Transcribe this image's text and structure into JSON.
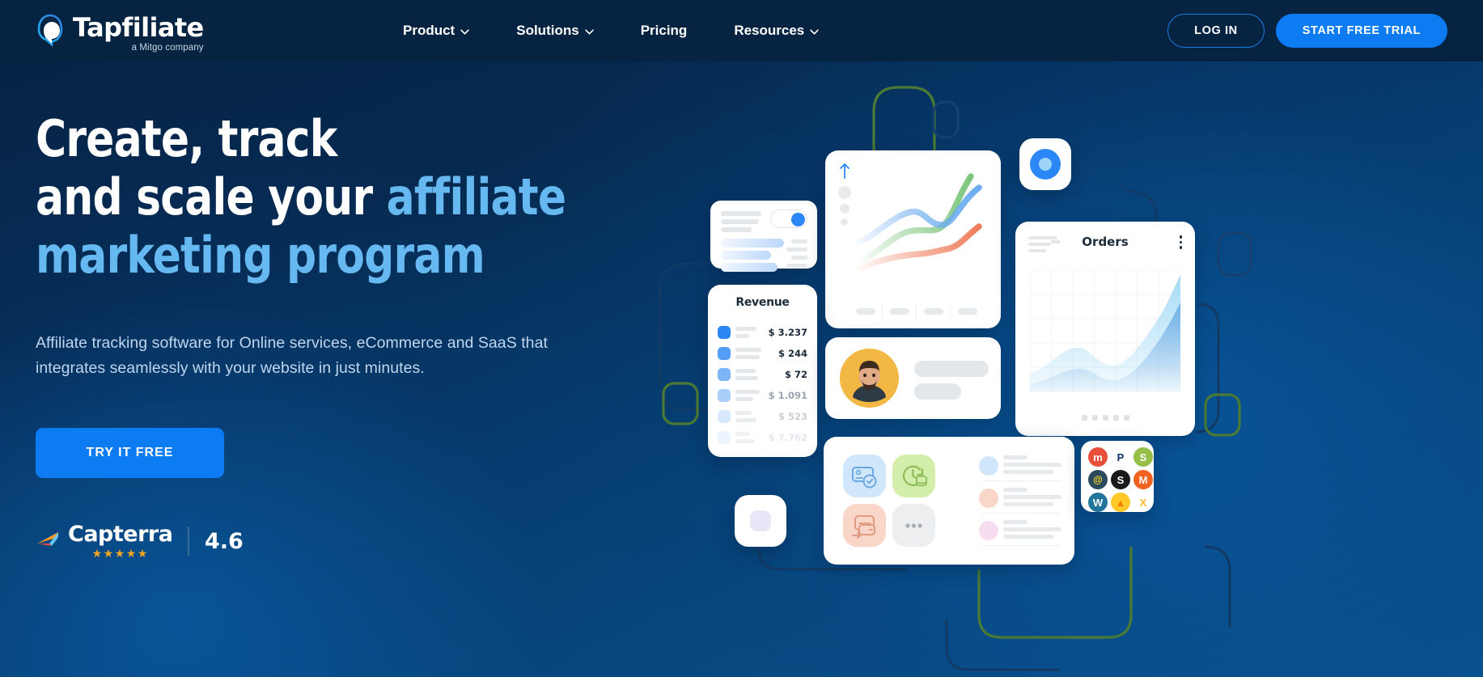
{
  "brand": {
    "name": "Tapfiliate",
    "tagline": "a Mitgo company",
    "logo_icon": "tapfiliate-logo-icon",
    "accent_color": "#0d7bf2",
    "headline_accent_color": "#66b8f0",
    "header_bg": "#062341"
  },
  "nav": {
    "items": [
      {
        "label": "Product",
        "has_dropdown": true,
        "icon": "chevron-down-icon"
      },
      {
        "label": "Solutions",
        "has_dropdown": true,
        "icon": "chevron-down-icon"
      },
      {
        "label": "Pricing",
        "has_dropdown": false,
        "icon": ""
      },
      {
        "label": "Resources",
        "has_dropdown": true,
        "icon": "chevron-down-icon"
      }
    ],
    "login_label": "LOG IN",
    "trial_label": "START FREE TRIAL"
  },
  "hero": {
    "headline_line1": "Create, track",
    "headline_line2_plain": "and scale your ",
    "headline_line2_accent": "affiliate",
    "headline_line3_accent": "marketing program",
    "subhead_line1": "Affiliate tracking software for Online services, eCommerce and SaaS that",
    "subhead_line2": "integrates seamlessly with your website in just minutes.",
    "cta_label": "TRY IT FREE"
  },
  "rating": {
    "source": "Capterra",
    "source_icon": "capterra-logo-icon",
    "stars": "★★★★★",
    "score": "4.6"
  },
  "illustration": {
    "toggle_card": {
      "name": "settings-toggle-card",
      "toggle_state": "on",
      "toggle_color": "#2b87f5"
    },
    "line_chart_card": {
      "name": "trend-chart-card",
      "arrow_icon": "arrow-up-icon",
      "series_colors": [
        "#7ec67e",
        "#6aabf0",
        "#ef7d5a"
      ],
      "footer_tabs": 4
    },
    "blue_dot_badge": {
      "name": "blue-target-badge",
      "outer_color": "#2b87f5",
      "inner_color": "#9fd4f9"
    },
    "revenue_card": {
      "title": "Revenue",
      "rows": [
        {
          "amount": "$ 3.237",
          "swatch": "#2b87f5",
          "amount_color": "#1c2b3a",
          "opacity": 1.0
        },
        {
          "amount": "$ 244",
          "swatch": "#549ef7",
          "amount_color": "#1c2b3a",
          "opacity": 1.0
        },
        {
          "amount": "$ 72",
          "swatch": "#7cb6f9",
          "amount_color": "#1c2b3a",
          "opacity": 1.0
        },
        {
          "amount": "$ 1.091",
          "swatch": "#a8cffb",
          "amount_color": "#9aa5b1",
          "opacity": 0.8
        },
        {
          "amount": "$ 523",
          "swatch": "#cde2fd",
          "amount_color": "#b6bfc8",
          "opacity": 0.6
        },
        {
          "amount": "$ 7.762",
          "swatch": "#dfecfe",
          "amount_color": "#cfd6dd",
          "opacity": 0.45
        }
      ]
    },
    "orders_card": {
      "title": "Orders",
      "menu_icon": "kebab-menu-icon",
      "pagination_dots": 5
    },
    "avatar_card": {
      "name": "user-profile-card",
      "avatar_icon": "user-avatar",
      "avatar_bg": "#f2b843"
    },
    "tiles_card": {
      "tiles": [
        {
          "name": "payout-verified-icon",
          "bg": "#cfe6fb",
          "stroke": "#6aa9e0"
        },
        {
          "name": "recurring-payment-icon",
          "bg": "#d3eeab",
          "stroke": "#8fbd5c"
        },
        {
          "name": "wallet-transfer-icon",
          "bg": "#f9d6c7",
          "stroke": "#e09b80"
        },
        {
          "name": "more-options-icon",
          "bg": "#eceeef",
          "stroke": "#a8aeb4"
        }
      ],
      "list_dot_colors": [
        "#cfe6fb",
        "#f9d6c7",
        "#f7dcf0"
      ]
    },
    "integrations_card": {
      "name": "integrations-grid-card",
      "logos": [
        {
          "name": "mollie-icon",
          "glyph": "m",
          "bg": "#e8503a",
          "color": "#ffffff"
        },
        {
          "name": "paypal-icon",
          "glyph": "P",
          "bg": "#ffffff",
          "color": "#13306e"
        },
        {
          "name": "shopify-icon",
          "glyph": "S",
          "bg": "#95bf47",
          "color": "#ffffff"
        },
        {
          "name": "mailchimp-icon",
          "glyph": "@",
          "bg": "#2b4a5e",
          "color": "#ffe01b"
        },
        {
          "name": "squarespace-icon",
          "glyph": "S",
          "bg": "#1a1a1a",
          "color": "#ffffff"
        },
        {
          "name": "magento-icon",
          "glyph": "M",
          "bg": "#f26322",
          "color": "#ffffff"
        },
        {
          "name": "wordpress-icon",
          "glyph": "W",
          "bg": "#21759b",
          "color": "#ffffff"
        },
        {
          "name": "firebase-icon",
          "glyph": "▲",
          "bg": "#ffca28",
          "color": "#f57c00"
        },
        {
          "name": "wix-icon",
          "glyph": "X",
          "bg": "#ffffff",
          "color": "#fbbd2e"
        }
      ]
    },
    "purple_card": {
      "name": "purple-square-badge",
      "color": "#e9e6f7"
    },
    "decor": {
      "green_stroke": "#4a7a33",
      "navy_stroke": "#123a66"
    }
  },
  "chart_data": [
    {
      "type": "line",
      "title": "",
      "name": "trend-chart",
      "x": [
        0,
        1,
        2,
        3,
        4,
        5
      ],
      "series": [
        {
          "name": "green",
          "color": "#7ec67e",
          "values": [
            10,
            22,
            38,
            35,
            46,
            92
          ]
        },
        {
          "name": "blue",
          "color": "#6aabf0",
          "values": [
            30,
            44,
            56,
            50,
            56,
            82
          ]
        },
        {
          "name": "orange",
          "color": "#ef7d5a",
          "values": [
            5,
            14,
            22,
            20,
            26,
            54
          ]
        }
      ],
      "grid": false,
      "legend": "none"
    },
    {
      "type": "area",
      "title": "Orders",
      "name": "orders-chart",
      "x": [
        0,
        1,
        2,
        3,
        4,
        5,
        6,
        7,
        8
      ],
      "series": [
        {
          "name": "upper",
          "color": "#9fd9f5",
          "values": [
            14,
            22,
            36,
            40,
            28,
            26,
            42,
            62,
            96
          ]
        },
        {
          "name": "lower",
          "color": "#5a9ee0",
          "values": [
            4,
            9,
            17,
            19,
            11,
            12,
            24,
            40,
            70
          ]
        }
      ],
      "grid": true,
      "legend": "none"
    },
    {
      "type": "bar",
      "title": "Revenue",
      "name": "revenue-list",
      "categories": [
        "row1",
        "row2",
        "row3",
        "row4",
        "row5",
        "row6"
      ],
      "values": [
        3237,
        244,
        72,
        1091,
        523,
        7762
      ],
      "value_labels": [
        "$ 3.237",
        "$ 244",
        "$ 72",
        "$ 1.091",
        "$ 523",
        "$ 7.762"
      ],
      "ylabel": "",
      "xlabel": ""
    }
  ]
}
